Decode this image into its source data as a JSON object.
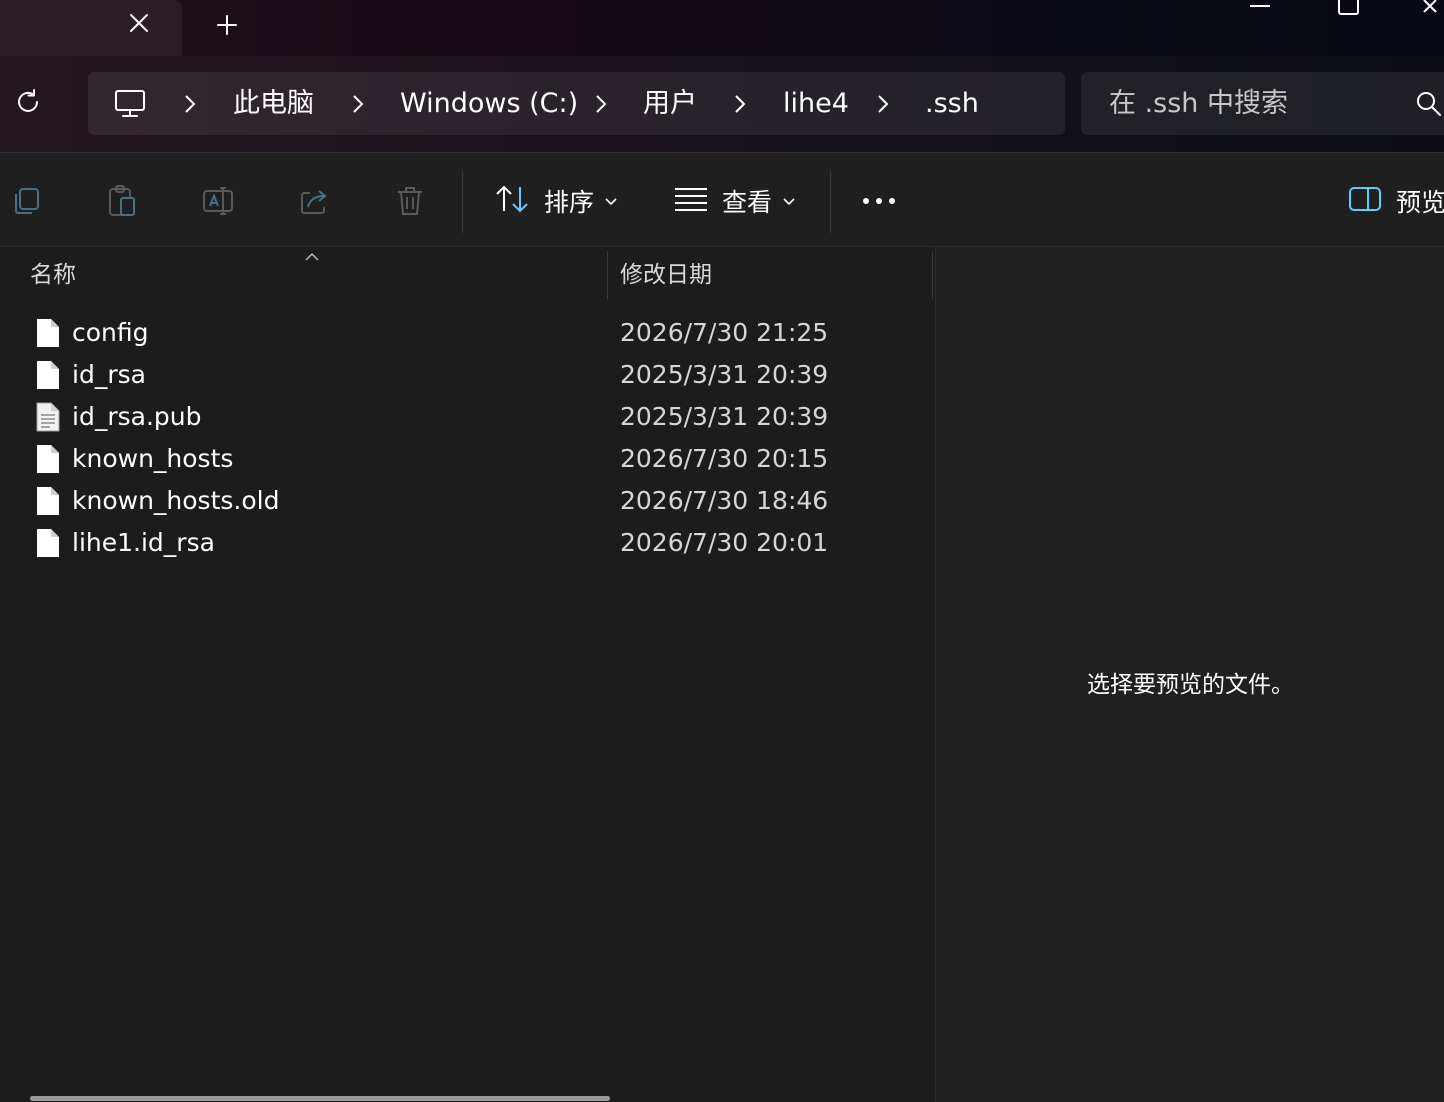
{
  "titlebar": {
    "tab_close_icon": "close-icon",
    "new_tab_icon": "plus-icon"
  },
  "address": {
    "breadcrumb": [
      "此电脑",
      "Windows (C:)",
      "用户",
      "lihe4",
      ".ssh"
    ],
    "search_placeholder": "在 .ssh 中搜索"
  },
  "toolbar": {
    "sort_label": "排序",
    "view_label": "查看",
    "preview_label": "预览"
  },
  "columns": {
    "name": "名称",
    "date_modified": "修改日期"
  },
  "files": [
    {
      "name": "config",
      "date": "2026/7/30 21:25",
      "icon": "blank-file-icon"
    },
    {
      "name": "id_rsa",
      "date": "2025/3/31 20:39",
      "icon": "blank-file-icon"
    },
    {
      "name": "id_rsa.pub",
      "date": "2025/3/31 20:39",
      "icon": "text-file-icon"
    },
    {
      "name": "known_hosts",
      "date": "2026/7/30 20:15",
      "icon": "blank-file-icon"
    },
    {
      "name": "known_hosts.old",
      "date": "2026/7/30 18:46",
      "icon": "blank-file-icon"
    },
    {
      "name": "lihe1.id_rsa",
      "date": "2026/7/30 20:01",
      "icon": "blank-file-icon"
    }
  ],
  "preview": {
    "message": "选择要预览的文件。"
  },
  "colors": {
    "background": "#1c1c1c",
    "preview_background": "#202020",
    "accent_blue": "#60cdff"
  }
}
